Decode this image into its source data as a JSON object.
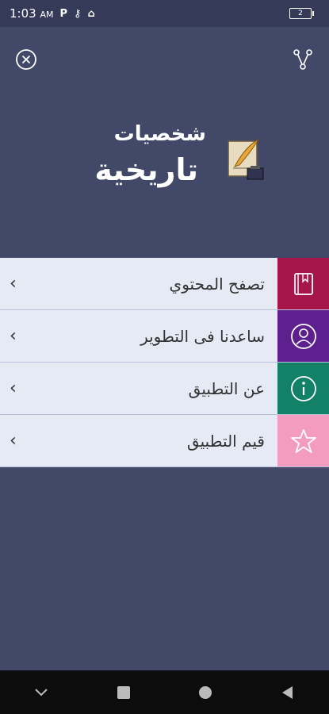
{
  "status": {
    "time": "1:03",
    "ampm": "AM",
    "battery": "2"
  },
  "logo": {
    "line1": "شخصيات",
    "line2": "تاريخية"
  },
  "menu": {
    "items": [
      {
        "label": "تصفح المحتوي",
        "icon": "book-icon",
        "color": "#a6164a"
      },
      {
        "label": "ساعدنا فى التطوير",
        "icon": "user-icon",
        "color": "#5e1f8f"
      },
      {
        "label": "عن التطبيق",
        "icon": "info-icon",
        "color": "#138068"
      },
      {
        "label": "قيم التطبيق",
        "icon": "star-icon",
        "color": "#f49cc0"
      }
    ]
  },
  "colors": {
    "background": "#424868",
    "statusbar": "#353a58",
    "menu_bg": "#e6eaf5"
  }
}
